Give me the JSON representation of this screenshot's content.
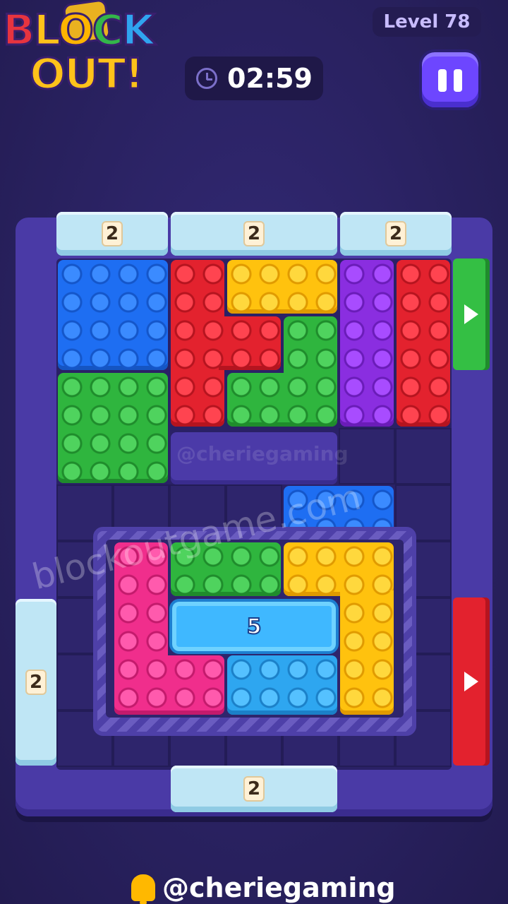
{
  "header": {
    "logo": {
      "line1": [
        "B",
        "L",
        "O",
        "C",
        "K"
      ],
      "line2": "OUT!"
    },
    "level_label": "Level 78",
    "timer": {
      "icon": "clock-icon",
      "value": "02:59"
    },
    "pause_icon": "pause-icon"
  },
  "board": {
    "top_gates": [
      {
        "count": "2"
      },
      {
        "count": "2"
      },
      {
        "count": "2"
      }
    ],
    "left_gate": {
      "count": "2"
    },
    "bottom_gate": {
      "count": "2"
    },
    "exits": [
      {
        "color": "#34bf44",
        "icon": "arrow-right-icon"
      },
      {
        "color": "#e3222e",
        "icon": "arrow-right-icon"
      }
    ],
    "ice_key": {
      "count": "5"
    },
    "block_colors": {
      "blue": "#1e6ef2",
      "red": "#e3222e",
      "yellow": "#ffc20e",
      "green": "#2fb53e",
      "purple": "#8a2ee0",
      "pink": "#f02e8c",
      "light_blue": "#2ea6f0"
    }
  },
  "watermarks": {
    "slab_text": "@cheriegaming",
    "diagonal_text": "blockoutgame.com"
  },
  "footer": {
    "icon": "bell-icon",
    "handle": "@cheriegaming"
  }
}
